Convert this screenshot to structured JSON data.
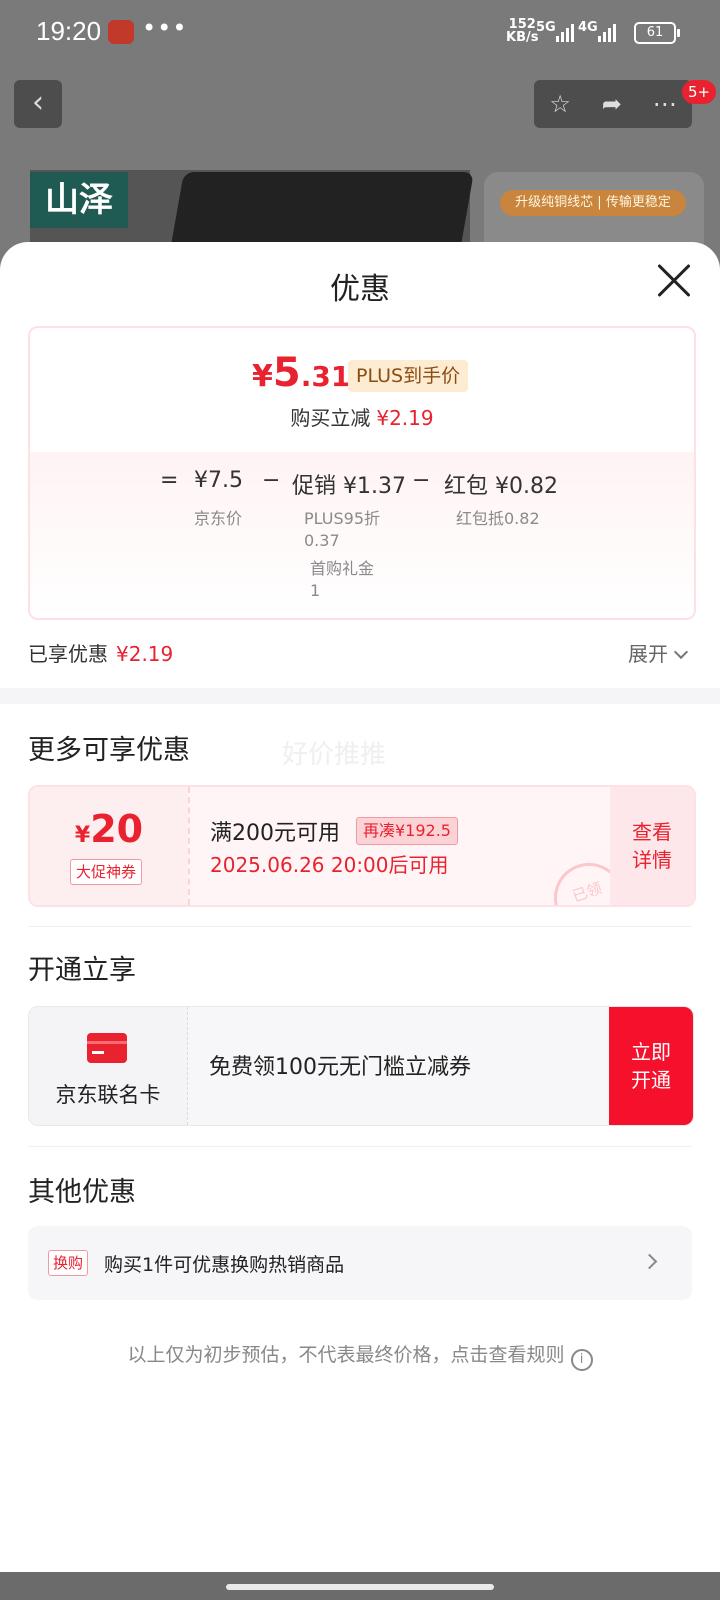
{
  "status_bar": {
    "time": "19:20",
    "dots": "•••",
    "speed_value": "152",
    "speed_unit": "KB/s",
    "network1": "5G",
    "network2": "4G",
    "battery": "61"
  },
  "background": {
    "brand_logo": "山泽",
    "banner_tag": "升级纯铜线芯 | 传输更稳定",
    "badge": "5+"
  },
  "sheet": {
    "title": "优惠",
    "price": {
      "symbol": "¥",
      "integer": "5",
      "decimal": ".31",
      "plus_tag": "PLUS到手价",
      "buy_reduce_label": "购买立减",
      "buy_reduce_value": "¥2.19"
    },
    "calc": {
      "equals": "=",
      "base_value": "¥7.5",
      "base_label": "京东价",
      "minus1": "−",
      "promo_label": "促销",
      "promo_value": "¥1.37",
      "promo_sub1": "PLUS95折",
      "promo_sub1_value": "0.37",
      "promo_sub2": "首购礼金",
      "promo_sub2_value": "1",
      "minus2": "−",
      "redpacket_label": "红包",
      "redpacket_value": "¥0.82",
      "redpacket_sub": "红包抵0.82"
    },
    "enjoyed_label": "已享优惠",
    "enjoyed_value": "¥2.19",
    "expand_label": "展开"
  },
  "more": {
    "title": "更多可享优惠",
    "watermark": "好价推推",
    "coupon": {
      "symbol": "¥",
      "amount": "20",
      "kind": "大促神券",
      "condition": "满200元可用",
      "need_more": "再凑¥192.5",
      "time": "2025.06.26 20:00后可用",
      "detail_line1": "查看",
      "detail_line2": "详情",
      "stamp": "已领"
    }
  },
  "open_enjoy": {
    "title": "开通立享",
    "card_name": "京东联名卡",
    "desc": "免费领100元无门槛立减券",
    "btn_line1": "立即",
    "btn_line2": "开通"
  },
  "other": {
    "title": "其他优惠",
    "tag": "换购",
    "text": "购买1件可优惠换购热销商品"
  },
  "disclaimer": "以上仅为初步预估，不代表最终价格，点击查看规则",
  "colors": {
    "accent_red": "#e8222f",
    "open_btn": "#f5112c",
    "plus_tag_bg": "#fdecd2"
  },
  "icons": [
    "back-icon",
    "star-icon",
    "share-icon",
    "more-icon",
    "close-icon",
    "chevron-down-icon",
    "bank-card-icon",
    "chevron-right-icon",
    "info-icon"
  ]
}
